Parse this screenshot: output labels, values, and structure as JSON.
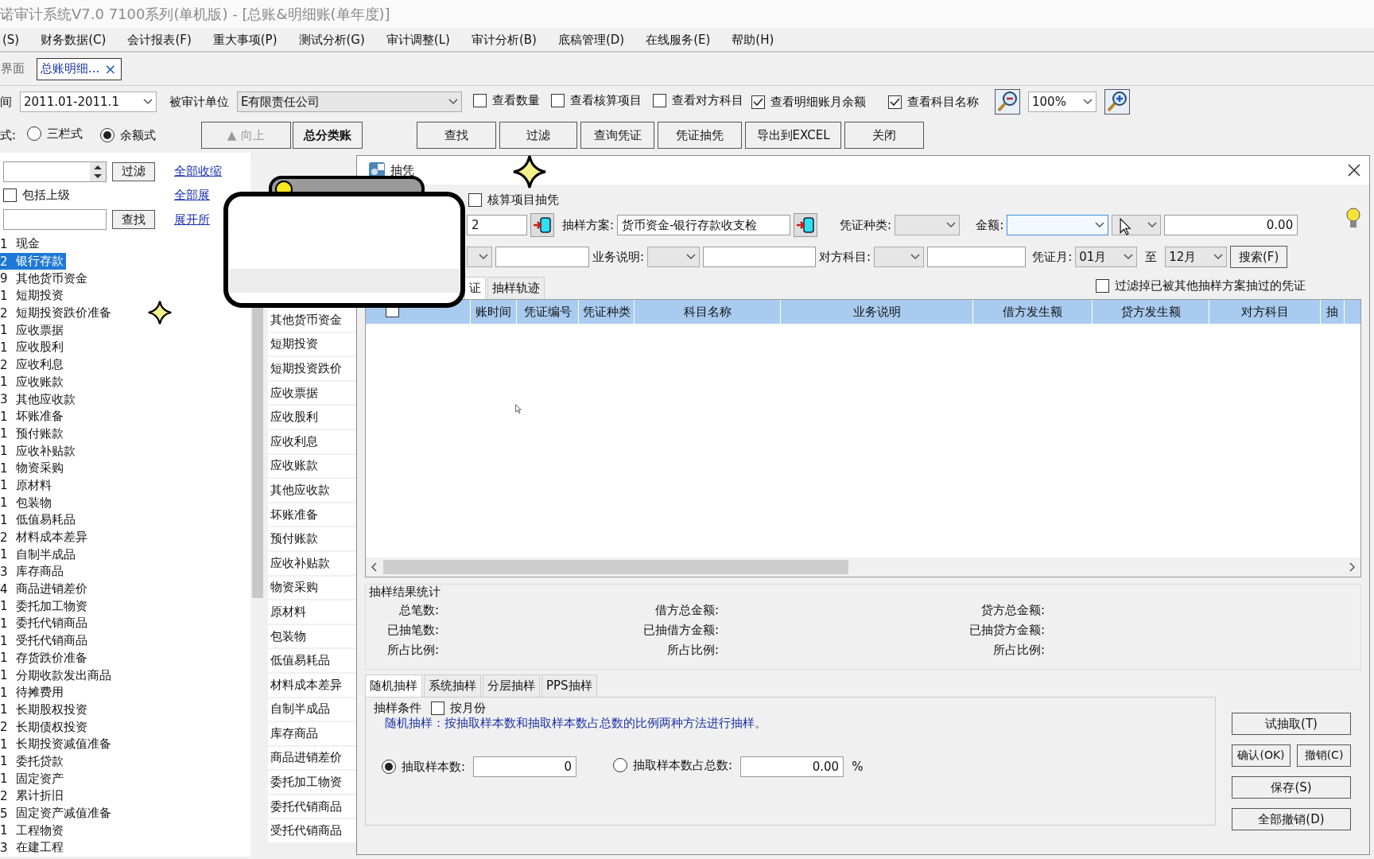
{
  "window": {
    "title": "诺审计系统V7.0 7100系列(单机版) - [总账&明细账(单年度)]"
  },
  "menu": [
    "(S)",
    "财务数据(C)",
    "会计报表(F)",
    "重大事项(P)",
    "测试分析(G)",
    "审计调整(L)",
    "审计分析(B)",
    "底稿管理(D)",
    "在线服务(E)",
    "帮助(H)"
  ],
  "doc_tabs": [
    {
      "label": "界面",
      "selected": false
    },
    {
      "label": "总账明细...",
      "selected": true,
      "close": "×"
    }
  ],
  "filter_bar": {
    "period_label": "间",
    "period": "2011.01-2011.1",
    "unit_label": "被审计单位",
    "unit": "E有限责任公司",
    "zoom": "100%",
    "options": [
      {
        "label": "查看数量",
        "checked": false
      },
      {
        "label": "查看核算项目",
        "checked": false
      },
      {
        "label": "查看对方科目",
        "checked": false
      },
      {
        "label": "查看明细账月余额",
        "checked": true
      },
      {
        "label": "查看科目名称",
        "checked": true
      }
    ]
  },
  "view_bar": {
    "format_label": "式:",
    "formats": [
      {
        "label": "三栏式",
        "selected": false
      },
      {
        "label": "余额式",
        "selected": true
      }
    ],
    "nav_buttons": [
      {
        "icon": "▲",
        "label": "向上",
        "disabled": true
      },
      {
        "label": "总分类账",
        "disabled": false
      }
    ],
    "actions": [
      "查找",
      "过滤",
      "查询凭证",
      "凭证抽凭",
      "导出到EXCEL",
      "关闭"
    ]
  },
  "account_panel": {
    "filter_button": "过滤",
    "include_parent": {
      "label": "包括上级",
      "checked": false
    },
    "search_button": "查找",
    "links": [
      "全部收缩",
      "全部展",
      "展开所"
    ],
    "tree": [
      {
        "code": "1",
        "name": "现金",
        "selected": false
      },
      {
        "code": "2",
        "name": "银行存款",
        "selected": true
      },
      {
        "code": "9",
        "name": "其他货币资金",
        "selected": false
      },
      {
        "code": "1",
        "name": "短期投资",
        "selected": false
      },
      {
        "code": "2",
        "name": "短期投资跌价准备",
        "selected": false
      },
      {
        "code": "1",
        "name": "应收票据",
        "selected": false
      },
      {
        "code": "1",
        "name": "应收股利",
        "selected": false
      },
      {
        "code": "2",
        "name": "应收利息",
        "selected": false
      },
      {
        "code": "1",
        "name": "应收账款",
        "selected": false
      },
      {
        "code": "3",
        "name": "其他应收款",
        "selected": false
      },
      {
        "code": "1",
        "name": "坏账准备",
        "selected": false
      },
      {
        "code": "1",
        "name": "预付账款",
        "selected": false
      },
      {
        "code": "1",
        "name": "应收补贴款",
        "selected": false
      },
      {
        "code": "1",
        "name": "物资采购",
        "selected": false
      },
      {
        "code": "1",
        "name": "原材料",
        "selected": false
      },
      {
        "code": "1",
        "name": "包装物",
        "selected": false
      },
      {
        "code": "1",
        "name": "低值易耗品",
        "selected": false
      },
      {
        "code": "2",
        "name": "材料成本差异",
        "selected": false
      },
      {
        "code": "1",
        "name": "自制半成品",
        "selected": false
      },
      {
        "code": "3",
        "name": "库存商品",
        "selected": false
      },
      {
        "code": "4",
        "name": "商品进销差价",
        "selected": false
      },
      {
        "code": "1",
        "name": "委托加工物资",
        "selected": false
      },
      {
        "code": "1",
        "name": "委托代销商品",
        "selected": false
      },
      {
        "code": "1",
        "name": "受托代销商品",
        "selected": false
      },
      {
        "code": "1",
        "name": "存货跌价准备",
        "selected": false
      },
      {
        "code": "1",
        "name": "分期收款发出商品",
        "selected": false
      },
      {
        "code": "1",
        "name": "待摊费用",
        "selected": false
      },
      {
        "code": "1",
        "name": "长期股权投资",
        "selected": false
      },
      {
        "code": "2",
        "name": "长期债权投资",
        "selected": false
      },
      {
        "code": "1",
        "name": "长期投资减值准备",
        "selected": false
      },
      {
        "code": "1",
        "name": "委托贷款",
        "selected": false
      },
      {
        "code": "1",
        "name": "固定资产",
        "selected": false
      },
      {
        "code": "2",
        "name": "累计折旧",
        "selected": false
      },
      {
        "code": "5",
        "name": "固定资产减值准备",
        "selected": false
      },
      {
        "code": "1",
        "name": "工程物资",
        "selected": false
      },
      {
        "code": "3",
        "name": "在建工程",
        "selected": false
      }
    ]
  },
  "account_list": [
    "其他货币资金",
    "短期投资",
    "短期投资跌价",
    "应收票据",
    "应收股利",
    "应收利息",
    "应收账款",
    "其他应收款",
    "坏账准备",
    "预付账款",
    "应收补贴款",
    "物资采购",
    "原材料",
    "包装物",
    "低值易耗品",
    "材料成本差异",
    "自制半成品",
    "库存商品",
    "商品进销差价",
    "委托加工物资",
    "委托代销商品",
    "受托代销商品"
  ],
  "dialog": {
    "title": "抽凭",
    "item_sampling": {
      "label": "核算项目抽凭",
      "checked": false
    },
    "code_value": "2",
    "scheme_label": "抽样方案:",
    "scheme": "货币资金-银行存款收支检",
    "voucher_type_label": "凭证种类:",
    "amount_label": "金额:",
    "amount_focused": true,
    "amount": "0.00",
    "description_label": "业务说明:",
    "counter_label": "对方科目:",
    "month_label": "凭证月:",
    "month_from": "01月",
    "to_label": "至",
    "month_to": "12月",
    "search_button": "搜索(F)",
    "tabs": [
      {
        "label": "证",
        "selected": true
      },
      {
        "label": "抽样轨迹",
        "selected": false
      }
    ],
    "exclude_sampled": {
      "label": "过滤掉已被其他抽样方案抽过的凭证",
      "checked": false
    },
    "header_checkbox": {
      "checked": false
    },
    "columns": [
      "账时间",
      "凭证编号",
      "凭证种类",
      "科目名称",
      "业务说明",
      "借方发生额",
      "贷方发生额",
      "对方科目",
      "抽"
    ],
    "stats": {
      "title": "抽样结果统计",
      "rows": [
        [
          "总笔数:",
          "借方总金额:",
          "贷方总金额:"
        ],
        [
          "已抽笔数:",
          "已抽借方金额:",
          "已抽贷方金额:"
        ],
        [
          "所占比例:",
          "所占比例:",
          "所占比例:"
        ]
      ]
    },
    "method_tabs": [
      {
        "label": "随机抽样",
        "selected": true
      },
      {
        "label": "系统抽样",
        "selected": false
      },
      {
        "label": "分层抽样",
        "selected": false
      },
      {
        "label": "PPS抽样",
        "selected": false
      }
    ],
    "conditions": {
      "title": "抽样条件",
      "by_month": {
        "label": "按月份",
        "checked": false
      },
      "note": "随机抽样：按抽取样本数和抽取样本数占总数的比例两种方法进行抽样。",
      "modes": [
        {
          "label": "抽取样本数:",
          "value": "0",
          "selected": true
        },
        {
          "label": "抽取样本数占总数:",
          "value": "0.00",
          "unit": "%",
          "selected": false
        }
      ]
    },
    "side_buttons": [
      "试抽取(T)",
      "确认(OK)",
      "撤销(C)",
      "保存(S)",
      "全部撤销(D)"
    ]
  }
}
